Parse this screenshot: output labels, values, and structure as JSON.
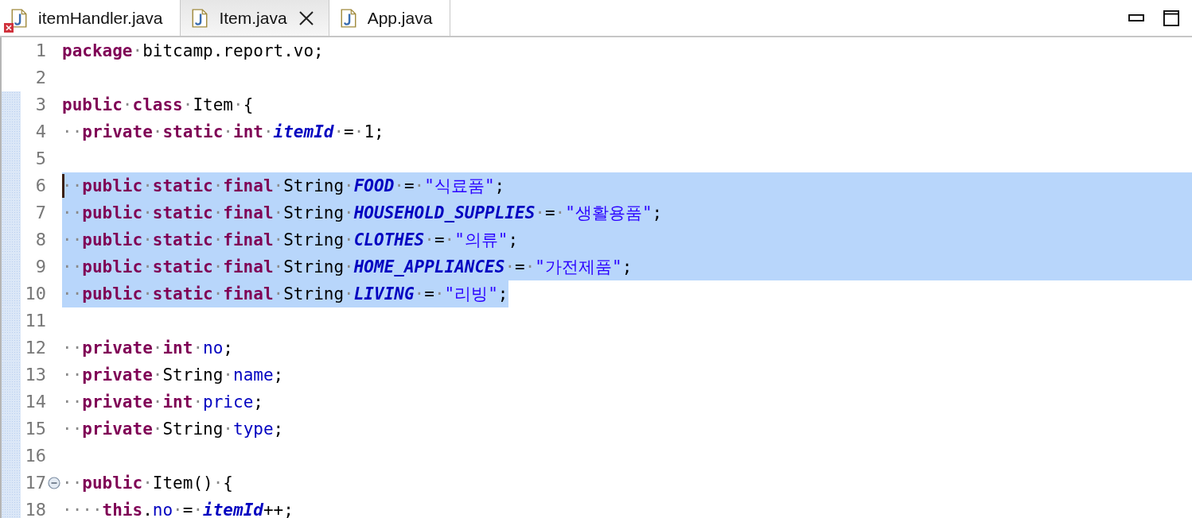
{
  "tabs": [
    {
      "label": "itemHandler.java",
      "selected": false,
      "error": true
    },
    {
      "label": "Item.java",
      "selected": true,
      "closable": true
    },
    {
      "label": "App.java",
      "selected": false
    }
  ],
  "lines": [
    {
      "number": "1",
      "changed": false,
      "selected": false,
      "tokens": [
        {
          "kind": "keyword",
          "text": "package"
        },
        {
          "kind": "whitespace",
          "text": "·"
        },
        {
          "kind": "plain",
          "text": "bitcamp.report.vo;"
        }
      ]
    },
    {
      "number": "2",
      "changed": false,
      "selected": false
    },
    {
      "number": "3",
      "changed": true,
      "selected": false,
      "tokens": [
        {
          "kind": "keyword",
          "text": "public"
        },
        {
          "kind": "whitespace",
          "text": "·"
        },
        {
          "kind": "keyword",
          "text": "class"
        },
        {
          "kind": "whitespace",
          "text": "·"
        },
        {
          "kind": "plain",
          "text": "Item"
        },
        {
          "kind": "whitespace",
          "text": "·"
        },
        {
          "kind": "plain",
          "text": "{"
        }
      ]
    },
    {
      "number": "4",
      "changed": true,
      "selected": false,
      "tokens": [
        {
          "kind": "whitespace",
          "text": "··"
        },
        {
          "kind": "keyword",
          "text": "private"
        },
        {
          "kind": "whitespace",
          "text": "·"
        },
        {
          "kind": "keyword",
          "text": "static"
        },
        {
          "kind": "whitespace",
          "text": "·"
        },
        {
          "kind": "keyword",
          "text": "int"
        },
        {
          "kind": "whitespace",
          "text": "·"
        },
        {
          "kind": "static_field",
          "text": "itemId"
        },
        {
          "kind": "whitespace",
          "text": "·"
        },
        {
          "kind": "plain",
          "text": "="
        },
        {
          "kind": "whitespace",
          "text": "·"
        },
        {
          "kind": "plain",
          "text": "1;"
        }
      ]
    },
    {
      "number": "5",
      "changed": true,
      "selected": false
    },
    {
      "number": "6",
      "changed": true,
      "selected": true,
      "cursor": true,
      "tokens": [
        {
          "kind": "whitespace",
          "text": "··"
        },
        {
          "kind": "keyword",
          "text": "public"
        },
        {
          "kind": "whitespace",
          "text": "·"
        },
        {
          "kind": "keyword",
          "text": "static"
        },
        {
          "kind": "whitespace",
          "text": "·"
        },
        {
          "kind": "keyword",
          "text": "final"
        },
        {
          "kind": "whitespace",
          "text": "·"
        },
        {
          "kind": "plain",
          "text": "String"
        },
        {
          "kind": "whitespace",
          "text": "·"
        },
        {
          "kind": "static_field",
          "text": "FOOD"
        },
        {
          "kind": "whitespace",
          "text": "·"
        },
        {
          "kind": "plain",
          "text": "="
        },
        {
          "kind": "whitespace",
          "text": "·"
        },
        {
          "kind": "string",
          "text": "\"식료품\""
        },
        {
          "kind": "plain",
          "text": ";"
        }
      ]
    },
    {
      "number": "7",
      "changed": true,
      "selected": true,
      "tokens": [
        {
          "kind": "whitespace",
          "text": "··"
        },
        {
          "kind": "keyword",
          "text": "public"
        },
        {
          "kind": "whitespace",
          "text": "·"
        },
        {
          "kind": "keyword",
          "text": "static"
        },
        {
          "kind": "whitespace",
          "text": "·"
        },
        {
          "kind": "keyword",
          "text": "final"
        },
        {
          "kind": "whitespace",
          "text": "·"
        },
        {
          "kind": "plain",
          "text": "String"
        },
        {
          "kind": "whitespace",
          "text": "·"
        },
        {
          "kind": "static_field",
          "text": "HOUSEHOLD_SUPPLIES"
        },
        {
          "kind": "whitespace",
          "text": "·"
        },
        {
          "kind": "plain",
          "text": "="
        },
        {
          "kind": "whitespace",
          "text": "·"
        },
        {
          "kind": "string",
          "text": "\"생활용품\""
        },
        {
          "kind": "plain",
          "text": ";"
        }
      ]
    },
    {
      "number": "8",
      "changed": true,
      "selected": true,
      "tokens": [
        {
          "kind": "whitespace",
          "text": "··"
        },
        {
          "kind": "keyword",
          "text": "public"
        },
        {
          "kind": "whitespace",
          "text": "·"
        },
        {
          "kind": "keyword",
          "text": "static"
        },
        {
          "kind": "whitespace",
          "text": "·"
        },
        {
          "kind": "keyword",
          "text": "final"
        },
        {
          "kind": "whitespace",
          "text": "·"
        },
        {
          "kind": "plain",
          "text": "String"
        },
        {
          "kind": "whitespace",
          "text": "·"
        },
        {
          "kind": "static_field",
          "text": "CLOTHES"
        },
        {
          "kind": "whitespace",
          "text": "·"
        },
        {
          "kind": "plain",
          "text": "="
        },
        {
          "kind": "whitespace",
          "text": "·"
        },
        {
          "kind": "string",
          "text": "\"의류\""
        },
        {
          "kind": "plain",
          "text": ";"
        }
      ]
    },
    {
      "number": "9",
      "changed": true,
      "selected": true,
      "tokens": [
        {
          "kind": "whitespace",
          "text": "··"
        },
        {
          "kind": "keyword",
          "text": "public"
        },
        {
          "kind": "whitespace",
          "text": "·"
        },
        {
          "kind": "keyword",
          "text": "static"
        },
        {
          "kind": "whitespace",
          "text": "·"
        },
        {
          "kind": "keyword",
          "text": "final"
        },
        {
          "kind": "whitespace",
          "text": "·"
        },
        {
          "kind": "plain",
          "text": "String"
        },
        {
          "kind": "whitespace",
          "text": "·"
        },
        {
          "kind": "static_field",
          "text": "HOME_APPLIANCES"
        },
        {
          "kind": "whitespace",
          "text": "·"
        },
        {
          "kind": "plain",
          "text": "="
        },
        {
          "kind": "whitespace",
          "text": "·"
        },
        {
          "kind": "string",
          "text": "\"가전제품\""
        },
        {
          "kind": "plain",
          "text": ";"
        }
      ]
    },
    {
      "number": "10",
      "changed": true,
      "selected": true,
      "tokens": [
        {
          "kind": "whitespace",
          "text": "··"
        },
        {
          "kind": "keyword",
          "text": "public"
        },
        {
          "kind": "whitespace",
          "text": "·"
        },
        {
          "kind": "keyword",
          "text": "static"
        },
        {
          "kind": "whitespace",
          "text": "·"
        },
        {
          "kind": "keyword",
          "text": "final"
        },
        {
          "kind": "whitespace",
          "text": "·"
        },
        {
          "kind": "plain",
          "text": "String"
        },
        {
          "kind": "whitespace",
          "text": "·"
        },
        {
          "kind": "static_field",
          "text": "LIVING"
        },
        {
          "kind": "whitespace",
          "text": "·"
        },
        {
          "kind": "plain",
          "text": "="
        },
        {
          "kind": "whitespace",
          "text": "·"
        },
        {
          "kind": "string",
          "text": "\"리빙\""
        },
        {
          "kind": "plain",
          "text": ";"
        }
      ]
    },
    {
      "number": "11",
      "changed": true,
      "selected": false
    },
    {
      "number": "12",
      "changed": true,
      "selected": false,
      "tokens": [
        {
          "kind": "whitespace",
          "text": "··"
        },
        {
          "kind": "keyword",
          "text": "private"
        },
        {
          "kind": "whitespace",
          "text": "·"
        },
        {
          "kind": "keyword",
          "text": "int"
        },
        {
          "kind": "whitespace",
          "text": "·"
        },
        {
          "kind": "field",
          "text": "no"
        },
        {
          "kind": "plain",
          "text": ";"
        }
      ]
    },
    {
      "number": "13",
      "changed": true,
      "selected": false,
      "tokens": [
        {
          "kind": "whitespace",
          "text": "··"
        },
        {
          "kind": "keyword",
          "text": "private"
        },
        {
          "kind": "whitespace",
          "text": "·"
        },
        {
          "kind": "plain",
          "text": "String"
        },
        {
          "kind": "whitespace",
          "text": "·"
        },
        {
          "kind": "field",
          "text": "name"
        },
        {
          "kind": "plain",
          "text": ";"
        }
      ]
    },
    {
      "number": "14",
      "changed": true,
      "selected": false,
      "tokens": [
        {
          "kind": "whitespace",
          "text": "··"
        },
        {
          "kind": "keyword",
          "text": "private"
        },
        {
          "kind": "whitespace",
          "text": "·"
        },
        {
          "kind": "keyword",
          "text": "int"
        },
        {
          "kind": "whitespace",
          "text": "·"
        },
        {
          "kind": "field",
          "text": "price"
        },
        {
          "kind": "plain",
          "text": ";"
        }
      ]
    },
    {
      "number": "15",
      "changed": true,
      "selected": false,
      "tokens": [
        {
          "kind": "whitespace",
          "text": "··"
        },
        {
          "kind": "keyword",
          "text": "private"
        },
        {
          "kind": "whitespace",
          "text": "·"
        },
        {
          "kind": "plain",
          "text": "String"
        },
        {
          "kind": "whitespace",
          "text": "·"
        },
        {
          "kind": "field",
          "text": "type"
        },
        {
          "kind": "plain",
          "text": ";"
        }
      ]
    },
    {
      "number": "16",
      "changed": true,
      "selected": false
    },
    {
      "number": "17",
      "changed": true,
      "selected": false,
      "collapsible": true,
      "tokens": [
        {
          "kind": "whitespace",
          "text": "··"
        },
        {
          "kind": "keyword",
          "text": "public"
        },
        {
          "kind": "whitespace",
          "text": "·"
        },
        {
          "kind": "plain",
          "text": "Item()"
        },
        {
          "kind": "whitespace",
          "text": "·"
        },
        {
          "kind": "plain",
          "text": "{"
        }
      ]
    },
    {
      "number": "18",
      "changed": true,
      "selected": false,
      "tokens": [
        {
          "kind": "whitespace",
          "text": "····"
        },
        {
          "kind": "keyword",
          "text": "this"
        },
        {
          "kind": "plain",
          "text": "."
        },
        {
          "kind": "field",
          "text": "no"
        },
        {
          "kind": "whitespace",
          "text": "·"
        },
        {
          "kind": "plain",
          "text": "="
        },
        {
          "kind": "whitespace",
          "text": "·"
        },
        {
          "kind": "static_field",
          "text": "itemId"
        },
        {
          "kind": "plain",
          "text": "++;"
        }
      ]
    }
  ]
}
